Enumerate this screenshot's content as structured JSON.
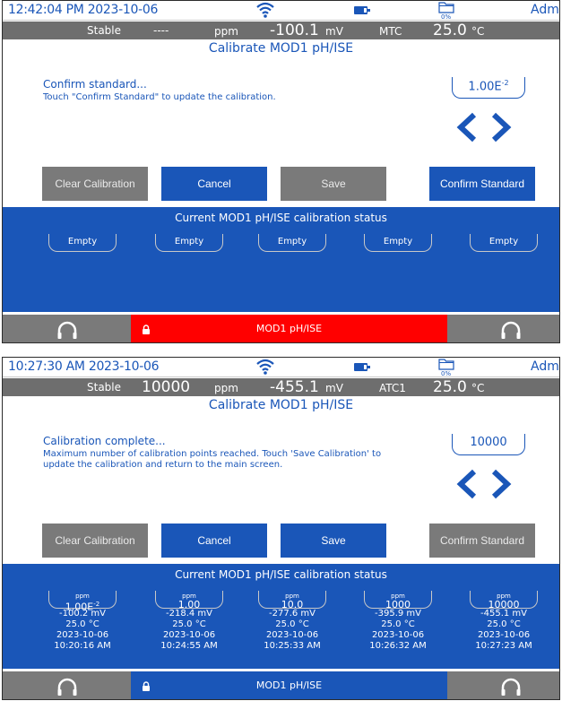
{
  "panels": [
    {
      "status": {
        "time": "12:42:04 PM 2023-10-06",
        "storage_pct": "0%",
        "user": "Admin"
      },
      "reading": {
        "status": "Stable",
        "concentration": "----",
        "conc_unit": "ppm",
        "mv": "-100.1",
        "mv_unit": "mV",
        "comp": "MTC",
        "temp": "25.0",
        "temp_unit": "°C"
      },
      "title": "Calibrate MOD1 pH/ISE",
      "prompt": "Confirm standard...",
      "instructions": "Touch \"Confirm Standard\" to update the calibration.",
      "standard": {
        "base": "1.00E",
        "exp": "-2"
      },
      "buttons": {
        "clear": "Clear Calibration",
        "cancel": "Cancel",
        "save": "Save",
        "confirm": "Confirm Standard"
      },
      "cal_title": "Current MOD1 pH/ISE calibration status",
      "slots": [
        "Empty",
        "Empty",
        "Empty",
        "Empty",
        "Empty"
      ],
      "probe": "MOD1 pH/ISE"
    },
    {
      "status": {
        "time": "10:27:30 AM 2023-10-06",
        "storage_pct": "0%",
        "user": "Admin"
      },
      "reading": {
        "status": "Stable",
        "concentration": "10000",
        "conc_unit": "ppm",
        "mv": "-455.1",
        "mv_unit": "mV",
        "comp": "ATC1",
        "temp": "25.0",
        "temp_unit": "°C"
      },
      "title": "Calibrate MOD1 pH/ISE",
      "prompt": "Calibration complete...",
      "instructions": "Maximum number of calibration points reached.  Touch 'Save Calibration' to update the calibration and return to the main screen.",
      "standard": {
        "value": "10000"
      },
      "buttons": {
        "clear": "Clear Calibration",
        "cancel": "Cancel",
        "save": "Save",
        "confirm": "Confirm Standard"
      },
      "cal_title": "Current MOD1 pH/ISE calibration status",
      "points": [
        {
          "unit": "ppm",
          "std_base": "1.00E",
          "std_exp": "-2",
          "mv": "-100.2 mV",
          "temp": "25.0 °C",
          "date": "2023-10-06",
          "time": "10:20:16 AM"
        },
        {
          "unit": "ppm",
          "std": "1.00",
          "mv": "-218.4 mV",
          "temp": "25.0 °C",
          "date": "2023-10-06",
          "time": "10:24:55 AM"
        },
        {
          "unit": "ppm",
          "std": "10.0",
          "mv": "-277.6 mV",
          "temp": "25.0 °C",
          "date": "2023-10-06",
          "time": "10:25:33 AM"
        },
        {
          "unit": "ppm",
          "std": "1000",
          "mv": "-395.9 mV",
          "temp": "25.0 °C",
          "date": "2023-10-06",
          "time": "10:26:32 AM"
        },
        {
          "unit": "ppm",
          "std": "10000",
          "mv": "-455.1 mV",
          "temp": "25.0 °C",
          "date": "2023-10-06",
          "time": "10:27:23 AM"
        }
      ],
      "probe": "MOD1 pH/ISE"
    }
  ],
  "icons": {
    "wifi": "wifi-icon",
    "battery": "battery-icon",
    "storage": "folder-icon",
    "audio": "headphone-icon",
    "lock": "lock-icon",
    "prev": "chevron-left-icon",
    "next": "chevron-right-icon"
  },
  "colors": {
    "brand_blue": "#1a56b8",
    "gray": "#7a7a7a",
    "alert_red": "#ff0000",
    "reading_bar": "#6e6e6e"
  }
}
